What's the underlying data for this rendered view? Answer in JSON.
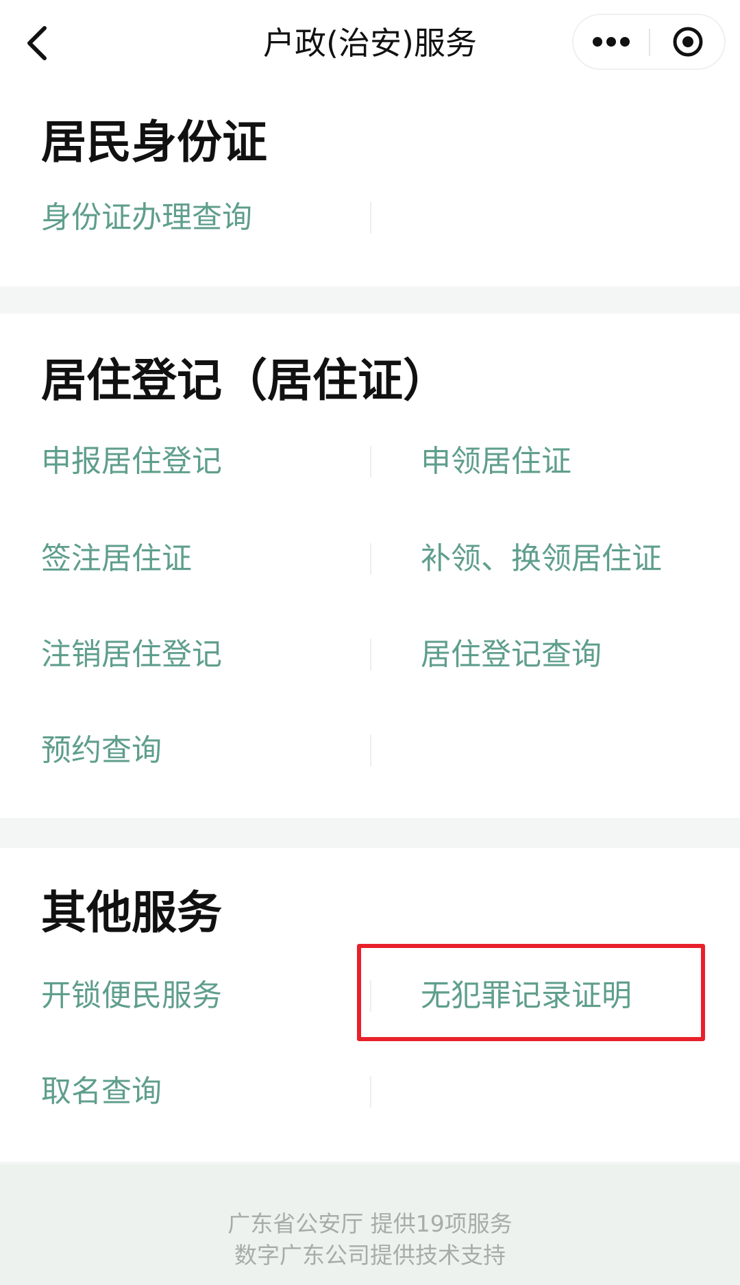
{
  "navbar": {
    "title": "户政(治安)服务",
    "back_icon": "chevron-left-icon",
    "more_icon": "more-dots-icon",
    "close_icon": "target-close-icon"
  },
  "sections": {
    "id_card": {
      "title": "居民身份证",
      "items": [
        "身份证办理查询"
      ]
    },
    "residence": {
      "title": "居住登记（居住证）",
      "items": [
        "申报居住登记",
        "申领居住证",
        "签注居住证",
        "补领、换领居住证",
        "注销居住登记",
        "居住登记查询",
        "预约查询"
      ]
    },
    "other": {
      "title": "其他服务",
      "items": [
        "开锁便民服务",
        "无犯罪记录证明",
        "取名查询"
      ]
    }
  },
  "footer": {
    "line1": "广东省公安厅 提供19项服务",
    "line2": "数字广东公司提供技术支持"
  },
  "colors": {
    "link_green": "#5f9e8c",
    "highlight_red": "#e8202a",
    "page_bg": "#f3f6f4"
  }
}
